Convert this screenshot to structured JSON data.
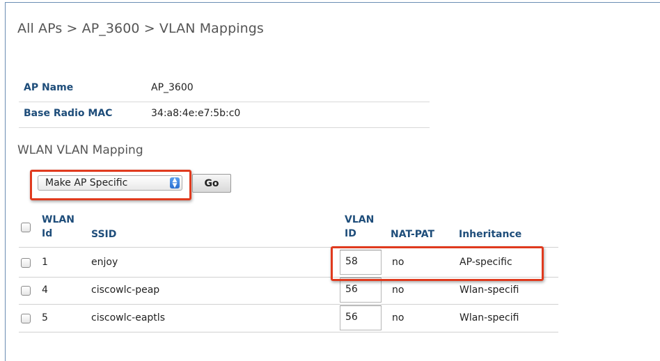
{
  "breadcrumb": "All APs > AP_3600 > VLAN Mappings",
  "ap_info": [
    {
      "label": "AP Name",
      "value": "AP_3600"
    },
    {
      "label": "Base Radio MAC",
      "value": "34:a8:4e:e7:5b:c0"
    }
  ],
  "section_title": "WLAN VLAN Mapping",
  "action_select": {
    "selected": "Make AP Specific"
  },
  "go_button": "Go",
  "table": {
    "headers": {
      "wlan_id_1": "WLAN",
      "wlan_id_2": "Id",
      "ssid": "SSID",
      "vlan_id_1": "VLAN",
      "vlan_id_2": "ID",
      "nat_pat": "NAT-PAT",
      "inheritance": "Inheritance"
    },
    "rows": [
      {
        "wlan_id": "1",
        "ssid": "enjoy",
        "vlan_id": "58",
        "nat_pat": "no",
        "inheritance": "AP-specific"
      },
      {
        "wlan_id": "4",
        "ssid": "ciscowlc-peap",
        "vlan_id": "56",
        "nat_pat": "no",
        "inheritance": "Wlan-specifi"
      },
      {
        "wlan_id": "5",
        "ssid": "ciscowlc-eaptls",
        "vlan_id": "56",
        "nat_pat": "no",
        "inheritance": "Wlan-specifi"
      }
    ]
  },
  "colors": {
    "highlight": "#e03a1e",
    "label_blue": "#1e4d7a"
  }
}
